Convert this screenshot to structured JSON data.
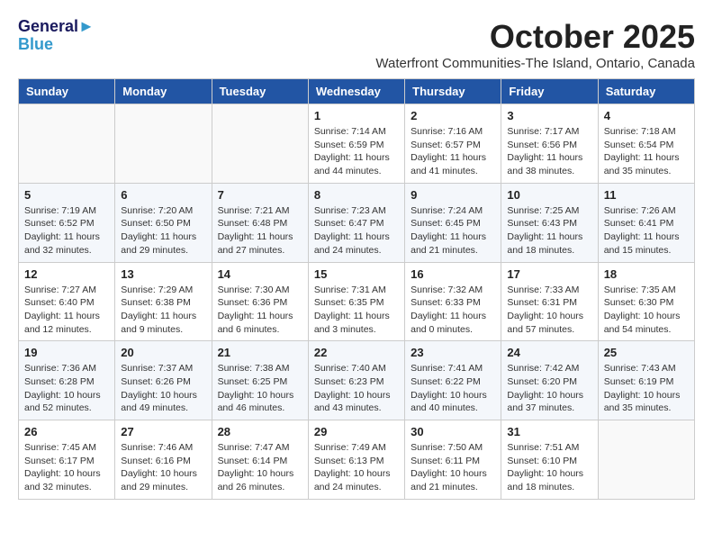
{
  "header": {
    "logo_line1": "General",
    "logo_line2": "Blue",
    "month": "October 2025",
    "location": "Waterfront Communities-The Island, Ontario, Canada"
  },
  "weekdays": [
    "Sunday",
    "Monday",
    "Tuesday",
    "Wednesday",
    "Thursday",
    "Friday",
    "Saturday"
  ],
  "weeks": [
    [
      {
        "day": "",
        "info": ""
      },
      {
        "day": "",
        "info": ""
      },
      {
        "day": "",
        "info": ""
      },
      {
        "day": "1",
        "info": "Sunrise: 7:14 AM\nSunset: 6:59 PM\nDaylight: 11 hours and 44 minutes."
      },
      {
        "day": "2",
        "info": "Sunrise: 7:16 AM\nSunset: 6:57 PM\nDaylight: 11 hours and 41 minutes."
      },
      {
        "day": "3",
        "info": "Sunrise: 7:17 AM\nSunset: 6:56 PM\nDaylight: 11 hours and 38 minutes."
      },
      {
        "day": "4",
        "info": "Sunrise: 7:18 AM\nSunset: 6:54 PM\nDaylight: 11 hours and 35 minutes."
      }
    ],
    [
      {
        "day": "5",
        "info": "Sunrise: 7:19 AM\nSunset: 6:52 PM\nDaylight: 11 hours and 32 minutes."
      },
      {
        "day": "6",
        "info": "Sunrise: 7:20 AM\nSunset: 6:50 PM\nDaylight: 11 hours and 29 minutes."
      },
      {
        "day": "7",
        "info": "Sunrise: 7:21 AM\nSunset: 6:48 PM\nDaylight: 11 hours and 27 minutes."
      },
      {
        "day": "8",
        "info": "Sunrise: 7:23 AM\nSunset: 6:47 PM\nDaylight: 11 hours and 24 minutes."
      },
      {
        "day": "9",
        "info": "Sunrise: 7:24 AM\nSunset: 6:45 PM\nDaylight: 11 hours and 21 minutes."
      },
      {
        "day": "10",
        "info": "Sunrise: 7:25 AM\nSunset: 6:43 PM\nDaylight: 11 hours and 18 minutes."
      },
      {
        "day": "11",
        "info": "Sunrise: 7:26 AM\nSunset: 6:41 PM\nDaylight: 11 hours and 15 minutes."
      }
    ],
    [
      {
        "day": "12",
        "info": "Sunrise: 7:27 AM\nSunset: 6:40 PM\nDaylight: 11 hours and 12 minutes."
      },
      {
        "day": "13",
        "info": "Sunrise: 7:29 AM\nSunset: 6:38 PM\nDaylight: 11 hours and 9 minutes."
      },
      {
        "day": "14",
        "info": "Sunrise: 7:30 AM\nSunset: 6:36 PM\nDaylight: 11 hours and 6 minutes."
      },
      {
        "day": "15",
        "info": "Sunrise: 7:31 AM\nSunset: 6:35 PM\nDaylight: 11 hours and 3 minutes."
      },
      {
        "day": "16",
        "info": "Sunrise: 7:32 AM\nSunset: 6:33 PM\nDaylight: 11 hours and 0 minutes."
      },
      {
        "day": "17",
        "info": "Sunrise: 7:33 AM\nSunset: 6:31 PM\nDaylight: 10 hours and 57 minutes."
      },
      {
        "day": "18",
        "info": "Sunrise: 7:35 AM\nSunset: 6:30 PM\nDaylight: 10 hours and 54 minutes."
      }
    ],
    [
      {
        "day": "19",
        "info": "Sunrise: 7:36 AM\nSunset: 6:28 PM\nDaylight: 10 hours and 52 minutes."
      },
      {
        "day": "20",
        "info": "Sunrise: 7:37 AM\nSunset: 6:26 PM\nDaylight: 10 hours and 49 minutes."
      },
      {
        "day": "21",
        "info": "Sunrise: 7:38 AM\nSunset: 6:25 PM\nDaylight: 10 hours and 46 minutes."
      },
      {
        "day": "22",
        "info": "Sunrise: 7:40 AM\nSunset: 6:23 PM\nDaylight: 10 hours and 43 minutes."
      },
      {
        "day": "23",
        "info": "Sunrise: 7:41 AM\nSunset: 6:22 PM\nDaylight: 10 hours and 40 minutes."
      },
      {
        "day": "24",
        "info": "Sunrise: 7:42 AM\nSunset: 6:20 PM\nDaylight: 10 hours and 37 minutes."
      },
      {
        "day": "25",
        "info": "Sunrise: 7:43 AM\nSunset: 6:19 PM\nDaylight: 10 hours and 35 minutes."
      }
    ],
    [
      {
        "day": "26",
        "info": "Sunrise: 7:45 AM\nSunset: 6:17 PM\nDaylight: 10 hours and 32 minutes."
      },
      {
        "day": "27",
        "info": "Sunrise: 7:46 AM\nSunset: 6:16 PM\nDaylight: 10 hours and 29 minutes."
      },
      {
        "day": "28",
        "info": "Sunrise: 7:47 AM\nSunset: 6:14 PM\nDaylight: 10 hours and 26 minutes."
      },
      {
        "day": "29",
        "info": "Sunrise: 7:49 AM\nSunset: 6:13 PM\nDaylight: 10 hours and 24 minutes."
      },
      {
        "day": "30",
        "info": "Sunrise: 7:50 AM\nSunset: 6:11 PM\nDaylight: 10 hours and 21 minutes."
      },
      {
        "day": "31",
        "info": "Sunrise: 7:51 AM\nSunset: 6:10 PM\nDaylight: 10 hours and 18 minutes."
      },
      {
        "day": "",
        "info": ""
      }
    ]
  ]
}
